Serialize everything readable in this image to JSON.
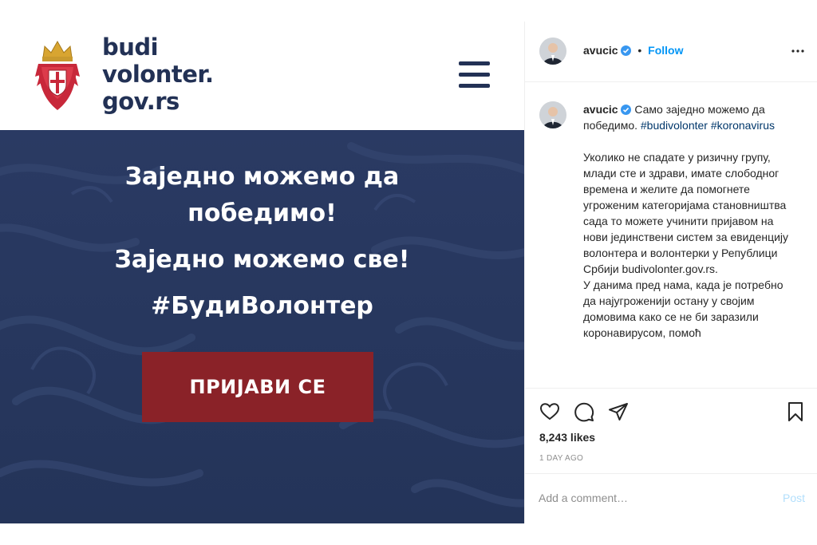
{
  "image": {
    "brand_lines": [
      "budi",
      "volonter.",
      "gov.rs"
    ],
    "hero_lines": [
      "Заједно можемо да",
      "победимо!",
      "Заједно можемо све!",
      "#БудиВолонтер"
    ],
    "cta_label": "ПРИЈАВИ СЕ",
    "icons": {
      "coat_of_arms": "serbia-coat-of-arms-icon",
      "menu": "hamburger-menu-icon"
    },
    "colors": {
      "navy": "#223155",
      "hero_bg": "#27375f",
      "cta": "#8a2228"
    }
  },
  "post": {
    "username": "avucic",
    "separator": "•",
    "follow_label": "Follow",
    "caption": {
      "first_text": "Само заједно можемо да победимо. ",
      "hashtags": [
        "#budivolonter",
        "#koronavirus"
      ],
      "body": "Уколико не спадате у ризичну групу, млади сте и здрави, имате слободног времена и желите да помогнете угроженим категоријама становништва сада то можете учинити пријавом на нови јединствени систем за евиденцију волонтера и волонтерки у Републици Србији budivolonter.gov.rs.",
      "body2": "У данима пред нама, када је потребно да најугроженији остану у својим домовима како се не би заразили коронавирусом, помоћ"
    },
    "likes": "8,243 likes",
    "time": "1 DAY AGO",
    "comment_placeholder": "Add a comment…",
    "post_label": "Post",
    "colors": {
      "link": "#0095f6",
      "hashtag": "#00376b",
      "muted": "#8e8e8e"
    }
  }
}
